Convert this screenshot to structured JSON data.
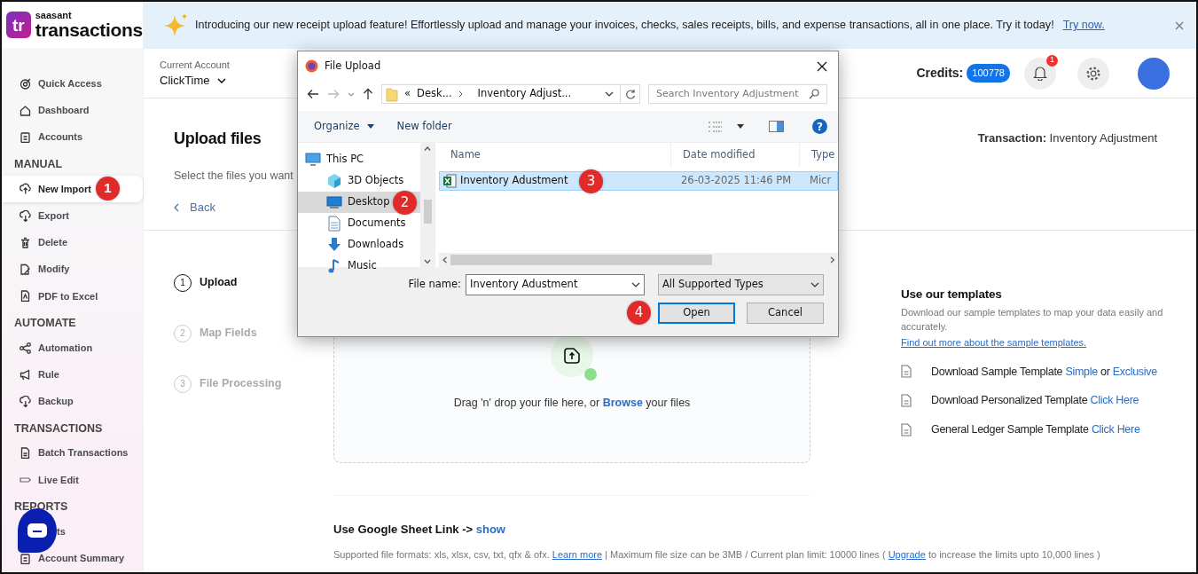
{
  "logo": {
    "brand": "saasant",
    "product": "transactions",
    "mark": "tr"
  },
  "banner": {
    "text": "Introducing our new receipt upload feature! Effortlessly upload and manage your invoices, checks, sales receipts, bills, and expense transactions, all in one place. Try it today!",
    "link": "Try now."
  },
  "sidebar": {
    "sections": [
      {
        "items": [
          {
            "label": "Quick Access",
            "selected": false
          },
          {
            "label": "Dashboard",
            "selected": false
          },
          {
            "label": "Accounts",
            "selected": false
          }
        ]
      },
      {
        "heading": "MANUAL",
        "items": [
          {
            "label": "New Import",
            "selected": true,
            "callout": "1"
          },
          {
            "label": "Export",
            "selected": false
          },
          {
            "label": "Delete",
            "selected": false
          },
          {
            "label": "Modify",
            "selected": false
          },
          {
            "label": "PDF to Excel",
            "selected": false
          }
        ]
      },
      {
        "heading": "AUTOMATE",
        "items": [
          {
            "label": "Automation",
            "selected": false
          },
          {
            "label": "Rule",
            "selected": false
          },
          {
            "label": "Backup",
            "selected": false
          }
        ]
      },
      {
        "heading": "TRANSACTIONS",
        "items": [
          {
            "label": "Batch Transactions",
            "selected": false
          },
          {
            "label": "Live Edit",
            "selected": false
          }
        ]
      },
      {
        "heading": "REPORTS",
        "items": [
          {
            "label": "ts",
            "selected": false
          },
          {
            "label": "Account Summary",
            "selected": false
          }
        ]
      }
    ]
  },
  "header": {
    "account_label": "Current Account",
    "account": "ClickTime",
    "credits_label": "Credits:",
    "credits": "100778",
    "notifications": "1"
  },
  "page": {
    "title": "Upload files",
    "subtitle": "Select the files you want",
    "back": "Back",
    "transaction_label": "Transaction:",
    "transaction": "Inventory Adjustment"
  },
  "steps": [
    {
      "number": "1",
      "label": "Upload",
      "selected": true
    },
    {
      "number": "2",
      "label": "Map Fields",
      "selected": false
    },
    {
      "number": "3",
      "label": "File Processing",
      "selected": false
    }
  ],
  "dropzone": {
    "before": "Drag 'n' drop your file here, or",
    "link": "Browse",
    "after": "your files"
  },
  "google_sheet": {
    "label": "Use Google Sheet Link ->",
    "link": "show"
  },
  "limits": [
    {
      "kind": "text",
      "text": "Supported file formats: xls, xlsx, csv, txt, qfx & ofx."
    },
    {
      "kind": "link",
      "text": "Learn more"
    },
    {
      "kind": "text",
      "text": "| Maximum file size can be 3MB / Current plan limit: 10000 lines ("
    },
    {
      "kind": "link",
      "text": "Upgrade"
    },
    {
      "kind": "text",
      "text": "to increase the limits upto 10,000 lines )"
    }
  ],
  "templates": {
    "title": "Use our templates",
    "description": "Download our sample templates to map your data easily and accurately.",
    "link": "Find out more about the sample templates.",
    "items": [
      [
        {
          "kind": "text",
          "text": "Download Sample Template"
        },
        {
          "kind": "link",
          "text": "Simple"
        },
        {
          "kind": "text",
          "text": "or"
        },
        {
          "kind": "link",
          "text": "Exclusive"
        }
      ],
      [
        {
          "kind": "text",
          "text": "Download Personalized Template"
        },
        {
          "kind": "link",
          "text": "Click Here"
        }
      ],
      [
        {
          "kind": "text",
          "text": "General Ledger Sample Template"
        },
        {
          "kind": "link",
          "text": "Click Here"
        }
      ]
    ]
  },
  "dialog": {
    "title": "File Upload",
    "overflow": "«",
    "crumbs": [
      "Desk...",
      "Inventory Adjust..."
    ],
    "search_placeholder": "Search Inventory Adjustment",
    "organize": "Organize",
    "new_folder": "New folder",
    "help": "?",
    "nav": [
      {
        "label": "This PC",
        "selected": false,
        "children": [
          {
            "label": "3D Objects",
            "selected": false
          },
          {
            "label": "Desktop",
            "selected": true,
            "callout": "2"
          },
          {
            "label": "Documents",
            "selected": false
          },
          {
            "label": "Downloads",
            "selected": false
          },
          {
            "label": "Music",
            "selected": false
          }
        ]
      }
    ],
    "columns": [
      "Name",
      "Date modified",
      "Type"
    ],
    "files": [
      {
        "name": "Inventory Adustment",
        "date": "26-03-2025 11:46 PM",
        "type": "Micr",
        "selected": true,
        "callout": "3"
      }
    ],
    "file_name_label": "File name:",
    "file_name": "Inventory Adustment",
    "filter": "All Supported Types",
    "buttons": [
      {
        "label": "Open",
        "default": true,
        "callout": "4"
      },
      {
        "label": "Cancel",
        "default": false
      }
    ]
  }
}
